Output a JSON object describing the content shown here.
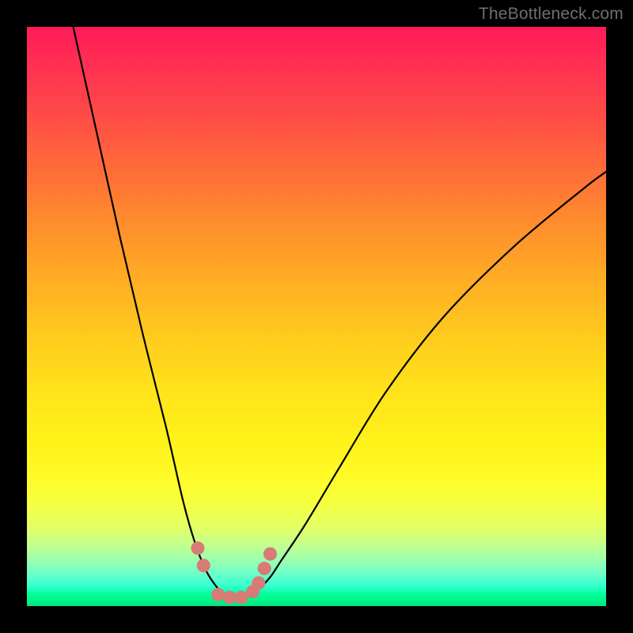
{
  "watermark": "TheBottleneck.com",
  "chart_data": {
    "type": "line",
    "title": "",
    "xlabel": "",
    "ylabel": "",
    "xlim": [
      0,
      100
    ],
    "ylim": [
      0,
      100
    ],
    "grid": false,
    "series": [
      {
        "name": "bottleneck-curve",
        "x": [
          8,
          12,
          16,
          20,
          24,
          27,
          29,
          31,
          33,
          34,
          35,
          36,
          38,
          40,
          42,
          44,
          48,
          54,
          62,
          72,
          84,
          96,
          100
        ],
        "y": [
          100,
          82,
          64,
          47,
          31,
          18,
          11,
          6,
          3,
          2,
          1.5,
          1.5,
          2,
          3,
          5,
          8,
          14,
          24,
          37,
          50,
          62,
          72,
          75
        ]
      }
    ],
    "markers": {
      "name": "highlight-dots",
      "color": "#d87a75",
      "x": [
        29.5,
        30.5,
        33,
        35,
        37,
        39,
        40,
        41,
        42
      ],
      "y": [
        10,
        7,
        2,
        1.5,
        1.5,
        2.5,
        4,
        6.5,
        9
      ]
    },
    "background_gradient": {
      "orientation": "vertical",
      "stops": [
        {
          "pos": 0,
          "color": "#ff1a58"
        },
        {
          "pos": 50,
          "color": "#ffd21c"
        },
        {
          "pos": 85,
          "color": "#eaff55"
        },
        {
          "pos": 100,
          "color": "#00e67a"
        }
      ]
    }
  }
}
